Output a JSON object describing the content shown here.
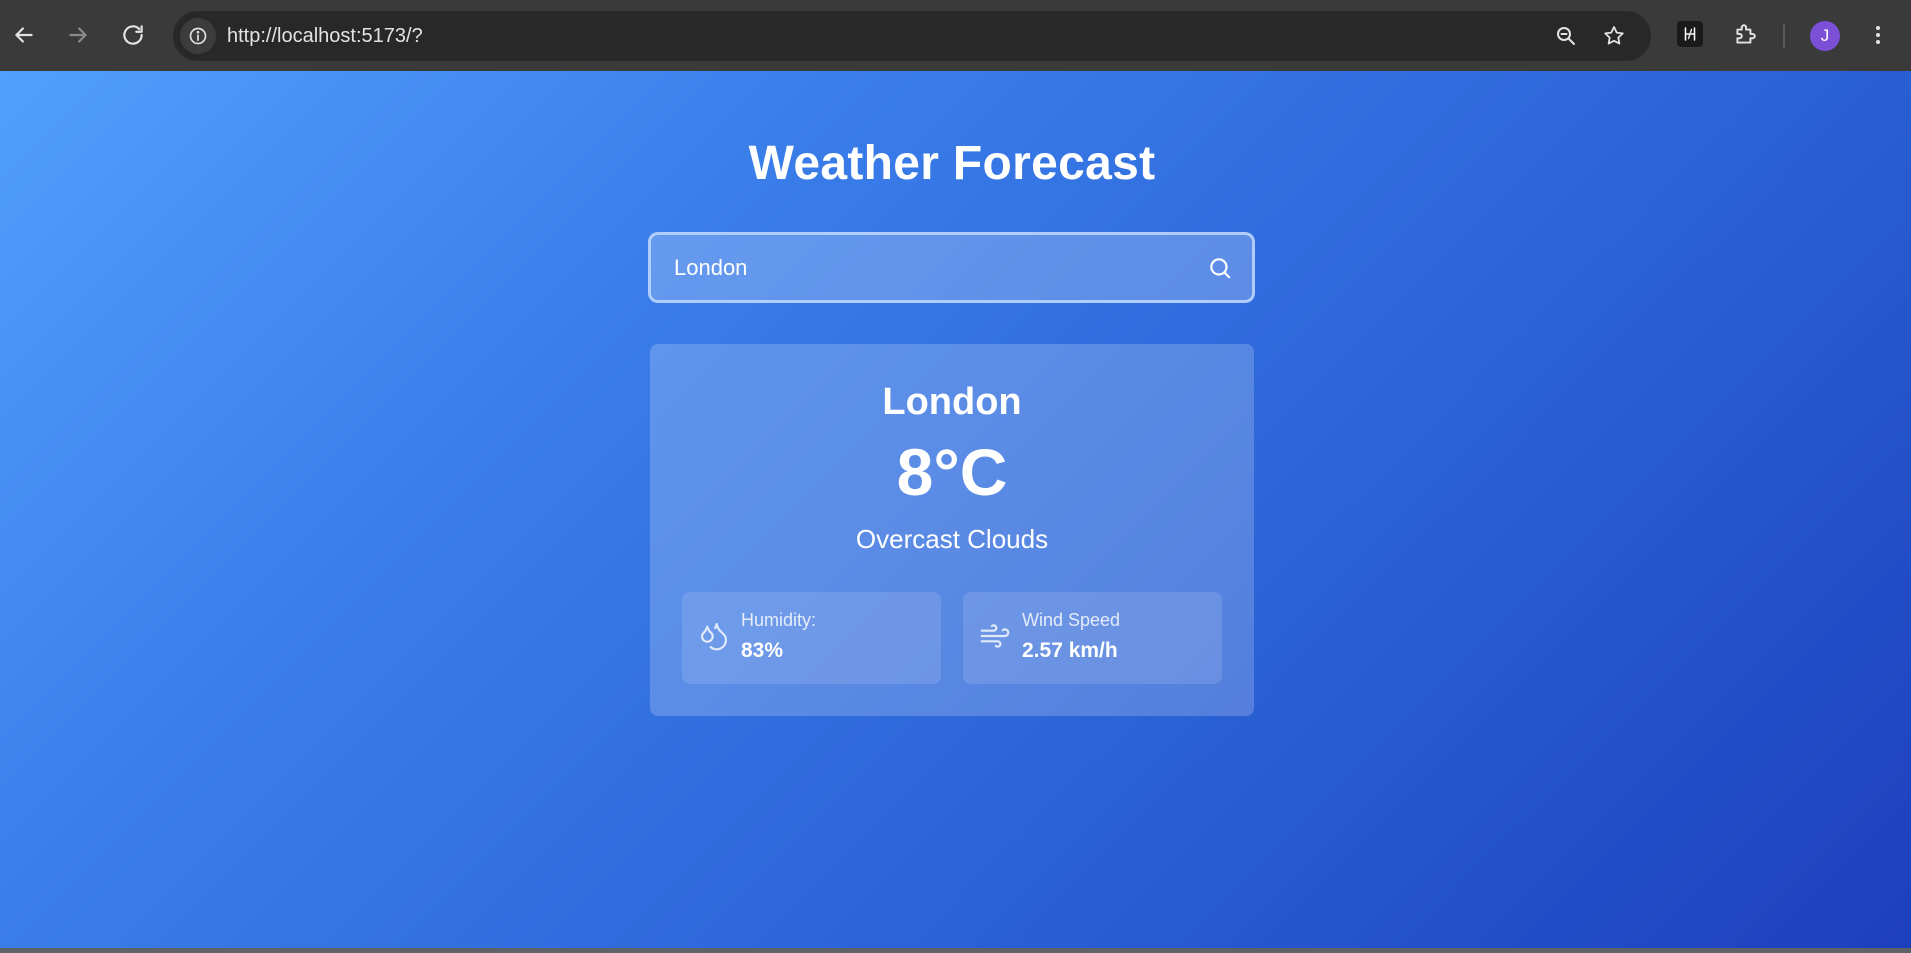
{
  "browser": {
    "url": "http://localhost:5173/?",
    "profile_initial": "J",
    "icons": {
      "back": "arrow-left-icon",
      "forward": "arrow-right-icon",
      "reload": "reload-icon",
      "site_info": "info-icon",
      "zoom": "zoom-icon",
      "bookmark": "star-icon",
      "extension": "extension-icon",
      "extensions_menu": "puzzle-icon",
      "menu": "kebab-menu-icon"
    }
  },
  "page": {
    "title": "Weather Forecast",
    "search": {
      "value": "London",
      "icon": "search-icon"
    },
    "weather": {
      "city": "London",
      "temperature": "8°C",
      "description": "Overcast Clouds",
      "humidity": {
        "label": "Humidity:",
        "value": "83%",
        "icon": "droplets-icon"
      },
      "wind": {
        "label": "Wind Speed",
        "value": "2.57 km/h",
        "icon": "wind-icon"
      }
    }
  },
  "colors": {
    "gradient_start": "#529ffc",
    "gradient_end": "#1d3fbe",
    "avatar": "#7b4fd6",
    "chrome": "#3a3a3a"
  }
}
